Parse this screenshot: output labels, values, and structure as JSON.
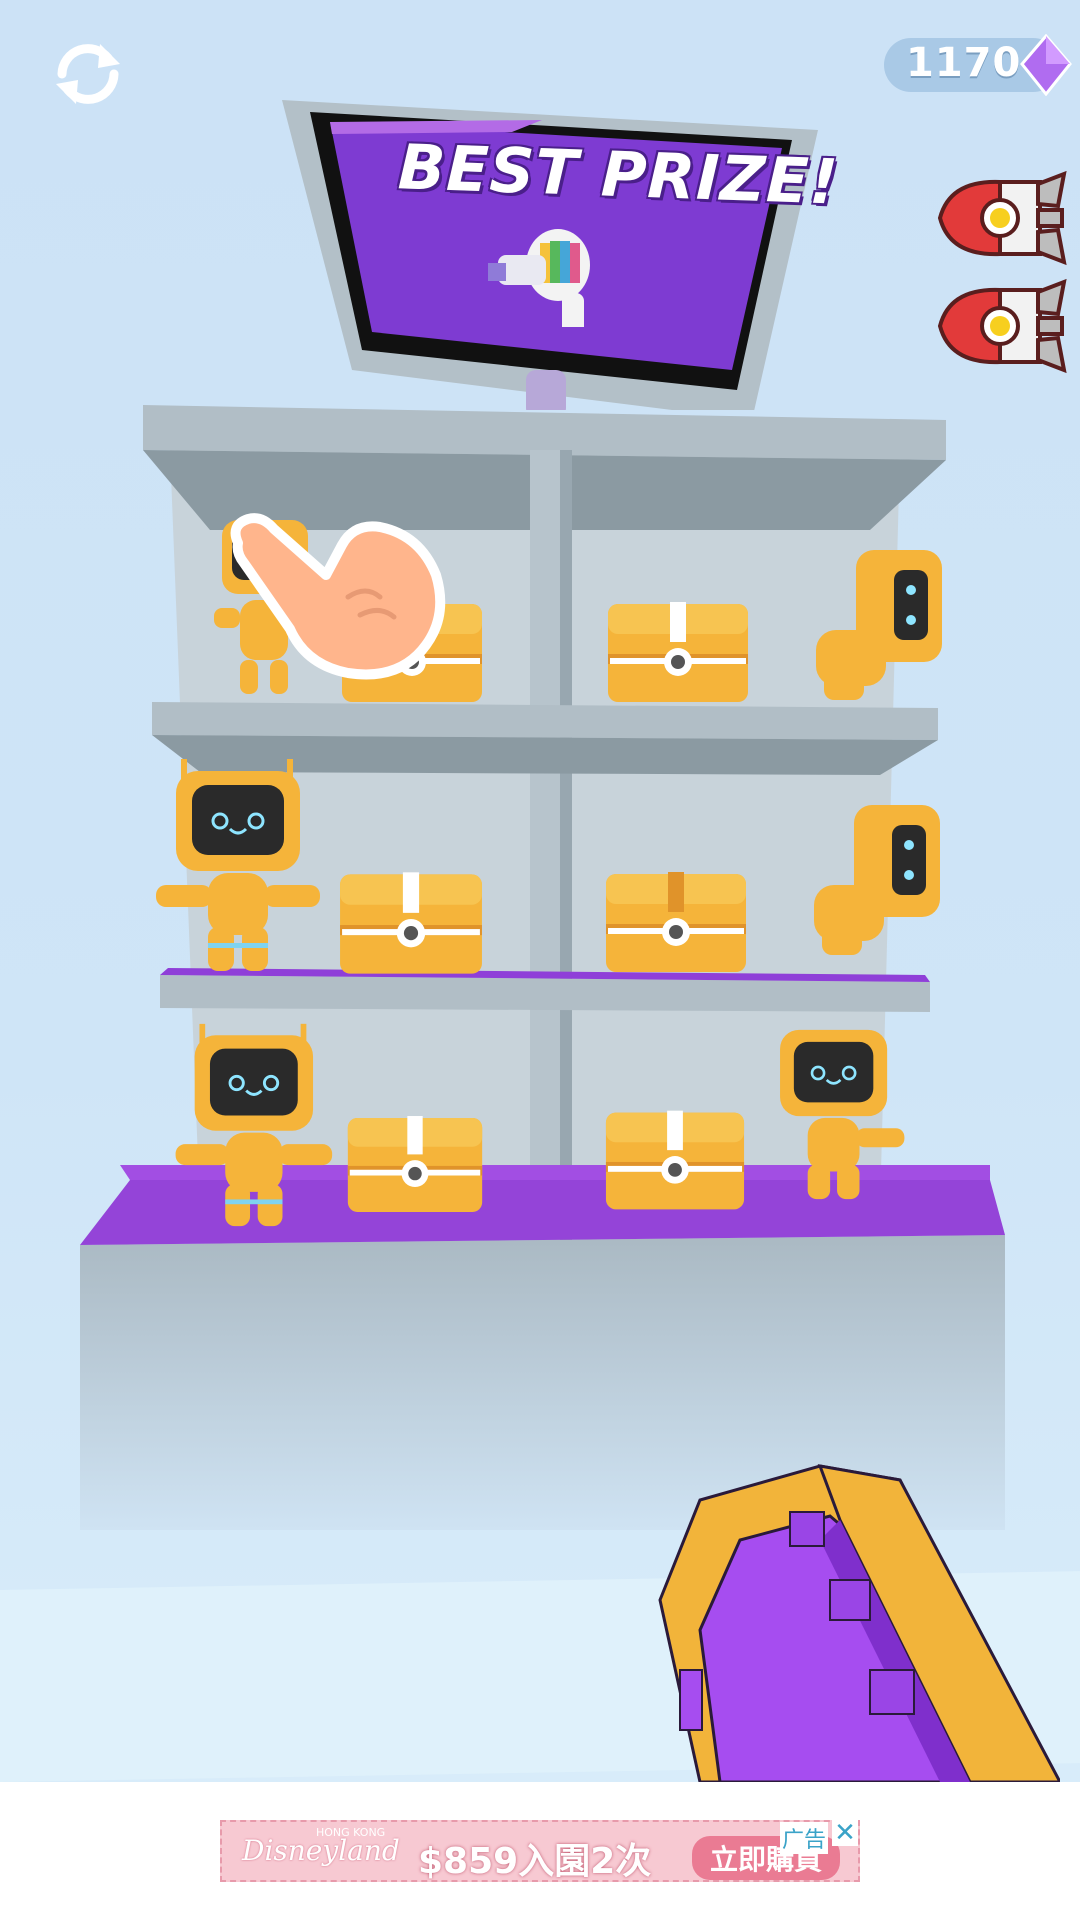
{
  "hud": {
    "gem_count": "1170",
    "refresh_icon": "refresh-icon",
    "gem_icon": "purple-diamond-icon",
    "rocket_count": 2
  },
  "tv": {
    "title": "BEST PRIZE!",
    "prize_icon": "robot-blaster-prize"
  },
  "shelf": {
    "rows": [
      {
        "row": 1,
        "items": [
          "robot",
          "chest",
          "chest",
          "robot"
        ]
      },
      {
        "row": 2,
        "items": [
          "robot",
          "chest",
          "chest",
          "robot"
        ]
      },
      {
        "row": 3,
        "items": [
          "robot",
          "chest",
          "chest",
          "robot"
        ]
      }
    ]
  },
  "tutorial": {
    "pointer_icon": "tap-hand-icon"
  },
  "weapon": {
    "name": "purple-blaster"
  },
  "ad": {
    "badge": "广告",
    "close": "✕",
    "brand": "Disneyland",
    "brand_region": "HONG KONG",
    "price_text": "$859入園2次",
    "cta": "立即購買"
  },
  "colors": {
    "sky": "#cce2f6",
    "shelf": "#b7c4cc",
    "shelf_dark": "#8a98a1",
    "purple": "#8f3fd8",
    "gold": "#f5b43a"
  }
}
